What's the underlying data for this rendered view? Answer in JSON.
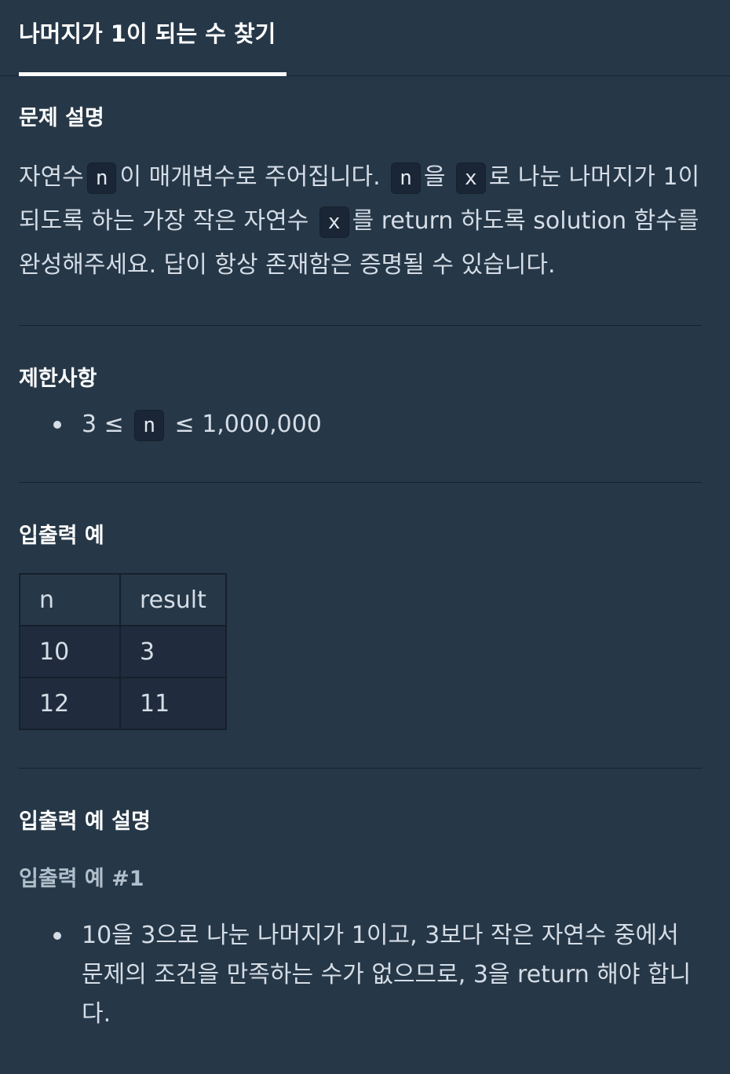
{
  "tab": {
    "title": "나머지가 1이 되는 수 찾기"
  },
  "description": {
    "heading": "문제 설명",
    "seg1": "자연수",
    "code_n1": "n",
    "seg2": "이 매개변수로 주어집니다.",
    "code_n2": "n",
    "seg3": "을",
    "code_x1": "x",
    "seg4": "로 나눈 나머지가 1이 되도록 하는 가장 작은 자연수",
    "code_x2": "x",
    "seg5": "를 return 하도록 solution 함수를 완성해주세요. 답이 항상 존재함은 증명될 수 있습니다."
  },
  "constraints": {
    "heading": "제한사항",
    "item_prefix": "3 ≤",
    "item_code": "n",
    "item_suffix": "≤ 1,000,000"
  },
  "examples": {
    "heading": "입출력 예",
    "columns": [
      "n",
      "result"
    ],
    "rows": [
      [
        "10",
        "3"
      ],
      [
        "12",
        "11"
      ]
    ]
  },
  "explanation": {
    "heading": "입출력 예 설명",
    "sub_heading": "입출력 예 #1",
    "item": "10을 3으로 나눈 나머지가 1이고, 3보다 작은 자연수 중에서 문제의 조건을 만족하는 수가 없으므로, 3을 return 해야 합니다."
  },
  "colors": {
    "background": "#263747",
    "text": "#d5dde6",
    "heading": "#ffffff",
    "code_bg": "#1a2636",
    "table_bg": "#202b3d"
  }
}
